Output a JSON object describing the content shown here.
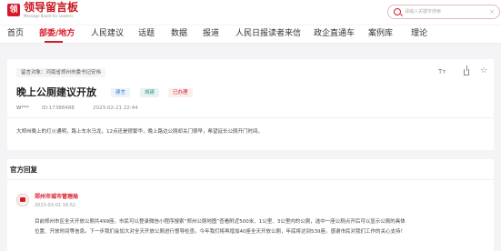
{
  "header": {
    "logo_mark": "领",
    "logo_title": "领导留言板",
    "logo_subtitle": "Message Board for Leaders",
    "search_placeholder": "请输入关键字搜索",
    "search_clear": "×"
  },
  "nav": {
    "items": [
      "首页",
      "部委/地方",
      "人民建议",
      "话题",
      "数据",
      "报道",
      "人民日报读者来信",
      "政企直通车",
      "案例库",
      "理论"
    ],
    "active_index": 1
  },
  "message": {
    "target": "留言对象：河南省郑州市委书记安伟",
    "title": "晚上公厕建议开放",
    "badges": [
      "建言",
      "城建",
      "已办理"
    ],
    "user": "W***",
    "id_text": "ID:17388488",
    "time": "2023-02-21 22:44",
    "toolbar": {
      "font_size": "Tт",
      "share": "share",
      "favorite": "☆"
    },
    "body": "大郑州晚上的灯火通明，路上车水马龙，12点还是很繁华，晚上路边公厕却关门很早，希望延长公厕开门时间。"
  },
  "reply": {
    "section_title": "官方回复",
    "org_name": "郑州市城市管理局",
    "time": "2023-03-01 16:52",
    "lines": [
      "目前郑州市区全天开放公厕共499座。市民可以登录微信小程序搜索“郑州公厕地图”查看附近500米、1公里、3公里内的公厕，选中一座公厕点开后可以显示公厕的具体",
      "位置、开放时间等信息。下一步我们会加大对全天开放公厕进行督导检查。今年我们将再增加40座全天开放公厕，年底将达到539座。感谢市民对我们工作的关心支持！"
    ]
  },
  "colors": {
    "brand_red": "#d7192a",
    "page_bg": "#f4f4f6"
  }
}
